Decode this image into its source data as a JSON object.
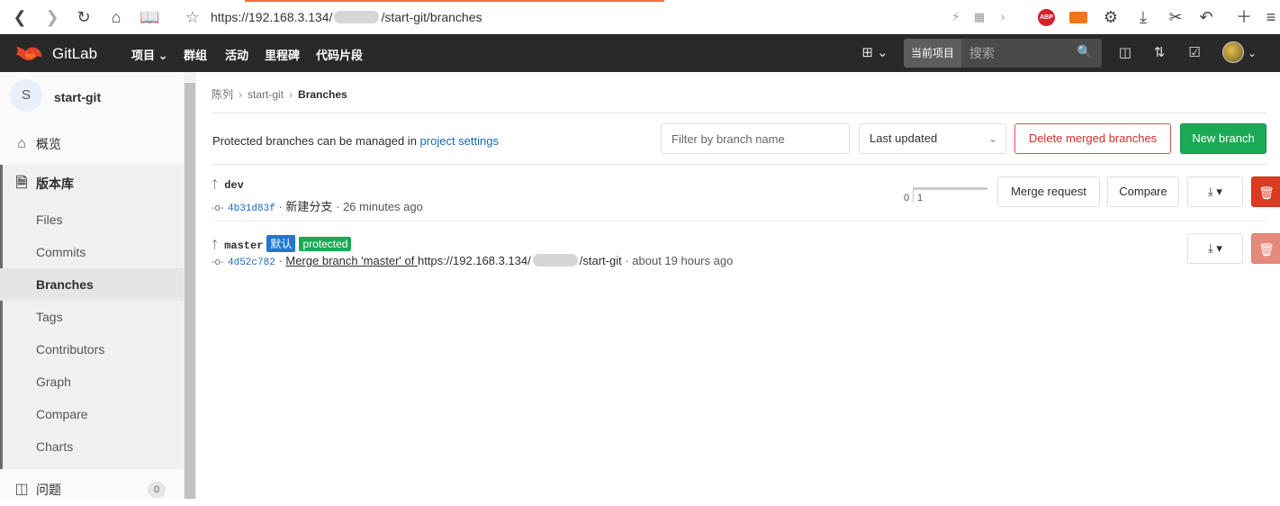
{
  "browser": {
    "url_prefix": "https://192.168.3.134/",
    "url_suffix": "/start-git/branches",
    "abp_label": "ABP"
  },
  "header": {
    "brand": "GitLab",
    "nav": [
      "项目",
      "群组",
      "活动",
      "里程碑",
      "代码片段"
    ],
    "search_scope": "当前项目",
    "search_placeholder": "搜索"
  },
  "sidebar": {
    "project_initial": "S",
    "project_name": "start-git",
    "overview": "概览",
    "repository": "版本库",
    "repo_items": [
      "Files",
      "Commits",
      "Branches",
      "Tags",
      "Contributors",
      "Graph",
      "Compare",
      "Charts"
    ],
    "active_item": "Branches",
    "issues": "问题",
    "issues_count": "0"
  },
  "breadcrumb": {
    "group": "陈列",
    "project": "start-git",
    "current": "Branches"
  },
  "toolbar": {
    "protected_text": "Protected branches can be managed in ",
    "protected_link": "project settings",
    "filter_placeholder": "Filter by branch name",
    "sort_value": "Last updated",
    "delete_merged_label": "Delete merged branches",
    "new_branch_label": "New branch"
  },
  "branches": [
    {
      "name": "dev",
      "sha": "4b31d83f",
      "message": "新建分支",
      "time": "26 minutes ago",
      "behind": "0",
      "ahead": "1",
      "merge_request_label": "Merge request",
      "compare_label": "Compare"
    },
    {
      "name": "master",
      "default_label": "默认",
      "protected_label": "protected",
      "sha": "4d52c782",
      "message_link": "Merge branch 'master' of ",
      "message_url_prefix": "https://192.168.3.134/",
      "message_url_suffix": "/start-git",
      "time": "about 19 hours ago"
    }
  ]
}
